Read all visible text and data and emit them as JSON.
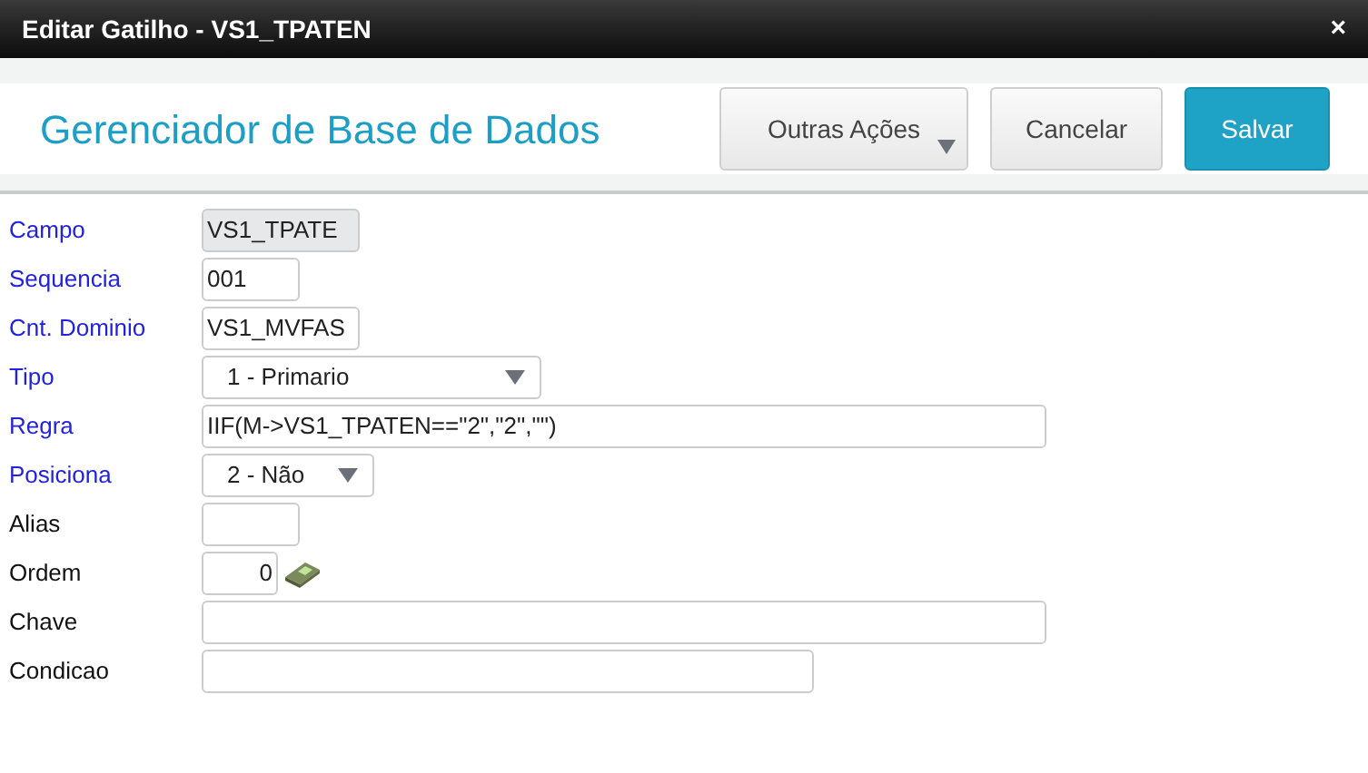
{
  "window": {
    "title": "Editar Gatilho - VS1_TPATEN",
    "close": "×"
  },
  "header": {
    "title": "Gerenciador de Base de Dados",
    "buttons": [
      {
        "label": "Outras Ações",
        "kind": "menu"
      },
      {
        "label": "Cancelar",
        "kind": "plain"
      },
      {
        "label": "Salvar",
        "kind": "primary"
      }
    ]
  },
  "fields": [
    {
      "label": "Campo",
      "required": true,
      "kind": "text",
      "value": "VS1_TPATE",
      "disabled": true
    },
    {
      "label": "Sequencia",
      "required": true,
      "kind": "text",
      "value": "001",
      "disabled": false
    },
    {
      "label": "Cnt. Dominio",
      "required": true,
      "kind": "text",
      "value": "VS1_MVFAS",
      "disabled": false
    },
    {
      "label": "Tipo",
      "required": true,
      "kind": "select",
      "value": "1 - Primario",
      "disabled": false
    },
    {
      "label": "Regra",
      "required": true,
      "kind": "text",
      "value": "IIF(M->VS1_TPATEN==\"2\",\"2\",\"\")",
      "disabled": false
    },
    {
      "label": "Posiciona",
      "required": true,
      "kind": "select",
      "value": "2 - Não",
      "disabled": false
    },
    {
      "label": "Alias",
      "required": false,
      "kind": "text",
      "disabled": false
    },
    {
      "label": "Ordem",
      "required": false,
      "kind": "spin",
      "value": "0",
      "disabled": false
    },
    {
      "label": "Chave",
      "required": false,
      "kind": "text",
      "disabled": false
    },
    {
      "label": "Condicao",
      "required": false,
      "kind": "text",
      "disabled": false
    }
  ]
}
